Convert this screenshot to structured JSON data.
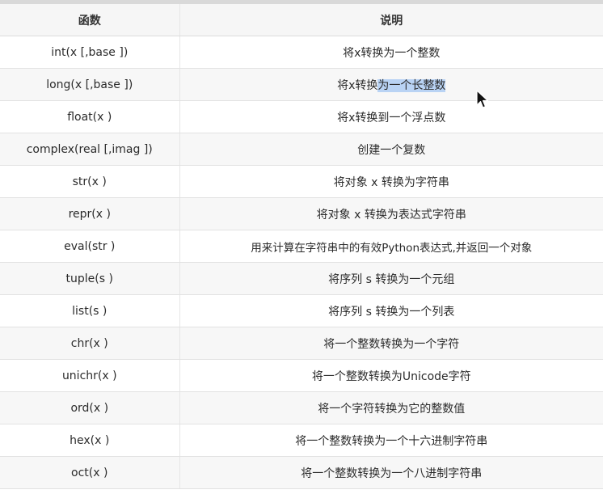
{
  "header": {
    "col1": "函数",
    "col2": "说明"
  },
  "rows": [
    {
      "func": "int(x [,base ])",
      "desc": "将x转换为一个整数"
    },
    {
      "func": "long(x [,base ])",
      "desc_pre": "将x转换",
      "desc_hl": "为一个长整数"
    },
    {
      "func": "float(x )",
      "desc": "将x转换到一个浮点数"
    },
    {
      "func": "complex(real [,imag ])",
      "desc": "创建一个复数"
    },
    {
      "func": "str(x )",
      "desc": "将对象 x 转换为字符串"
    },
    {
      "func": "repr(x )",
      "desc": "将对象 x 转换为表达式字符串"
    },
    {
      "func": "eval(str )",
      "desc": "用来计算在字符串中的有效Python表达式,并返回一个对象"
    },
    {
      "func": "tuple(s )",
      "desc": "将序列 s 转换为一个元组"
    },
    {
      "func": "list(s )",
      "desc": "将序列 s 转换为一个列表"
    },
    {
      "func": "chr(x )",
      "desc": "将一个整数转换为一个字符"
    },
    {
      "func": "unichr(x )",
      "desc": "将一个整数转换为Unicode字符"
    },
    {
      "func": "ord(x )",
      "desc": "将一个字符转换为它的整数值"
    },
    {
      "func": "hex(x )",
      "desc": "将一个整数转换为一个十六进制字符串"
    },
    {
      "func": "oct(x )",
      "desc": "将一个整数转换为一个八进制字符串"
    }
  ],
  "colors": {
    "highlight": "#b9d3f4",
    "header_bg": "#f6f6f6",
    "alt_row_bg": "#f7f7f7"
  },
  "icons": {
    "cursor": "mouse-pointer-icon"
  }
}
